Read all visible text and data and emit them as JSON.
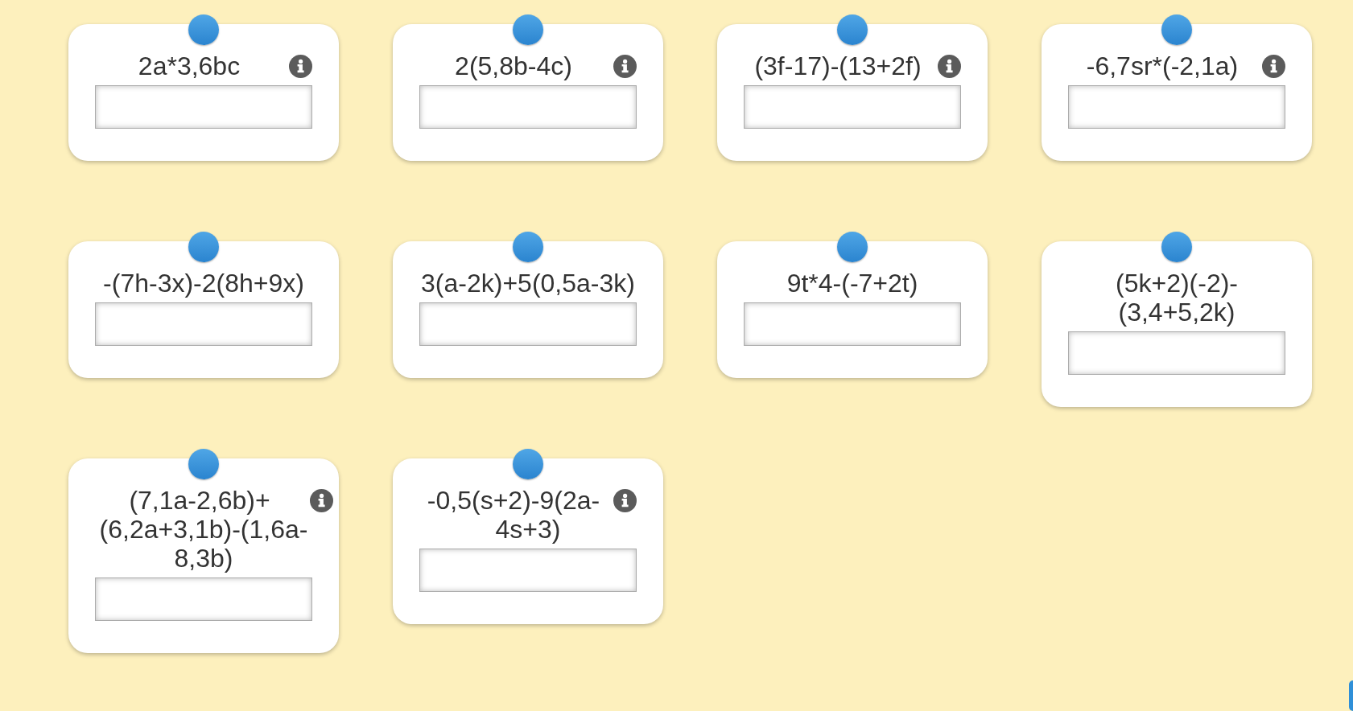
{
  "cards": [
    {
      "expression": "2a*3,6bc",
      "info": true
    },
    {
      "expression": "2(5,8b-4c)",
      "info": true
    },
    {
      "expression": "(3f-17)-(13+2f)",
      "info": true
    },
    {
      "expression": "-6,7sr*(-2,1a)",
      "info": true
    },
    {
      "expression": "-(7h-3x)-2(8h+9x)",
      "info": false
    },
    {
      "expression": "3(a-2k)+5(0,5a-3k)",
      "info": false
    },
    {
      "expression": "9t*4-(-7+2t)",
      "info": false
    },
    {
      "expression": "(5k+2)(-2)-\n(3,4+5,2k)",
      "info": false
    },
    {
      "expression": "(7,1a-2,6b)+\n(6,2a+3,1b)-(1,6a-\n8,3b)",
      "info": true
    },
    {
      "expression": "-0,5(s+2)-9(2a-\n4s+3)",
      "info": true
    }
  ]
}
